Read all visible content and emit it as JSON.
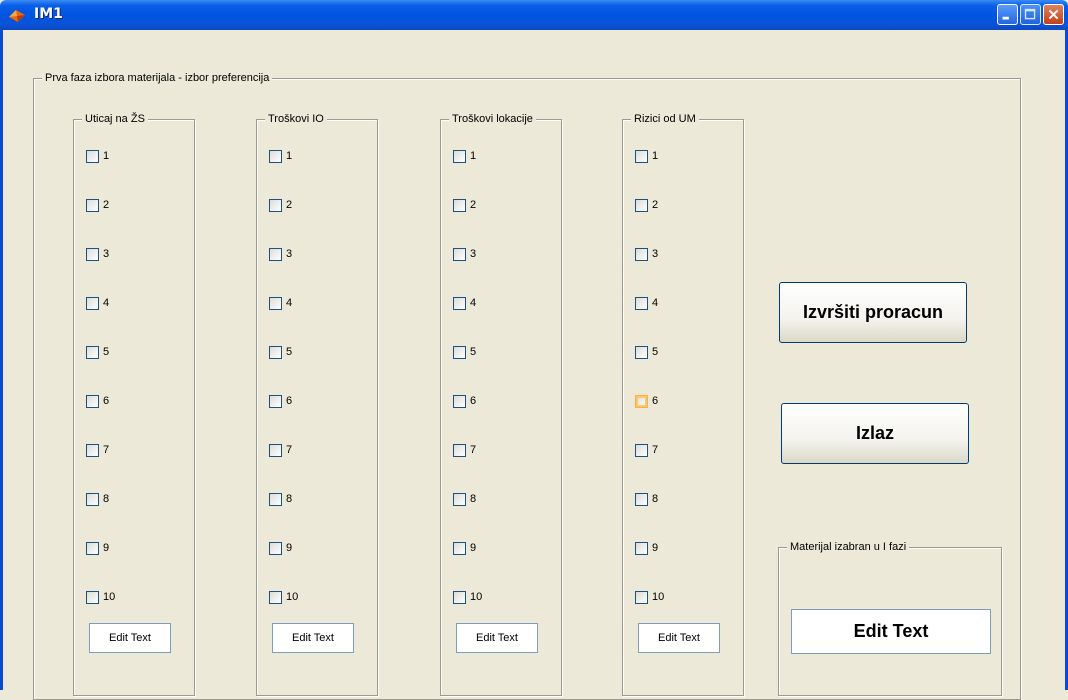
{
  "window": {
    "title": "IM1",
    "icon": "matlab-icon",
    "controls": [
      "minimize-icon",
      "maximize-icon",
      "close-icon"
    ]
  },
  "main_panel": {
    "title": "Prva faza izbora materijala - izbor preferencija"
  },
  "groups": [
    {
      "title": "Uticaj na ŽS",
      "options": [
        "1",
        "2",
        "3",
        "4",
        "5",
        "6",
        "7",
        "8",
        "9",
        "10"
      ],
      "edit_text": "Edit Text"
    },
    {
      "title": "Troškovi IO",
      "options": [
        "1",
        "2",
        "3",
        "4",
        "5",
        "6",
        "7",
        "8",
        "9",
        "10"
      ],
      "edit_text": "Edit Text"
    },
    {
      "title": "Troškovi lokacije",
      "options": [
        "1",
        "2",
        "3",
        "4",
        "5",
        "6",
        "7",
        "8",
        "9",
        "10"
      ],
      "edit_text": "Edit Text"
    },
    {
      "title": "Rizici od UM",
      "options": [
        "1",
        "2",
        "3",
        "4",
        "5",
        "6",
        "7",
        "8",
        "9",
        "10"
      ],
      "edit_text": "Edit Text",
      "hovered_option": "6"
    }
  ],
  "buttons": {
    "run_label": "Izvršiti proracun",
    "exit_label": "Izlaz"
  },
  "result_panel": {
    "title": "Materijal izabran u I fazi",
    "value": "Edit Text"
  }
}
